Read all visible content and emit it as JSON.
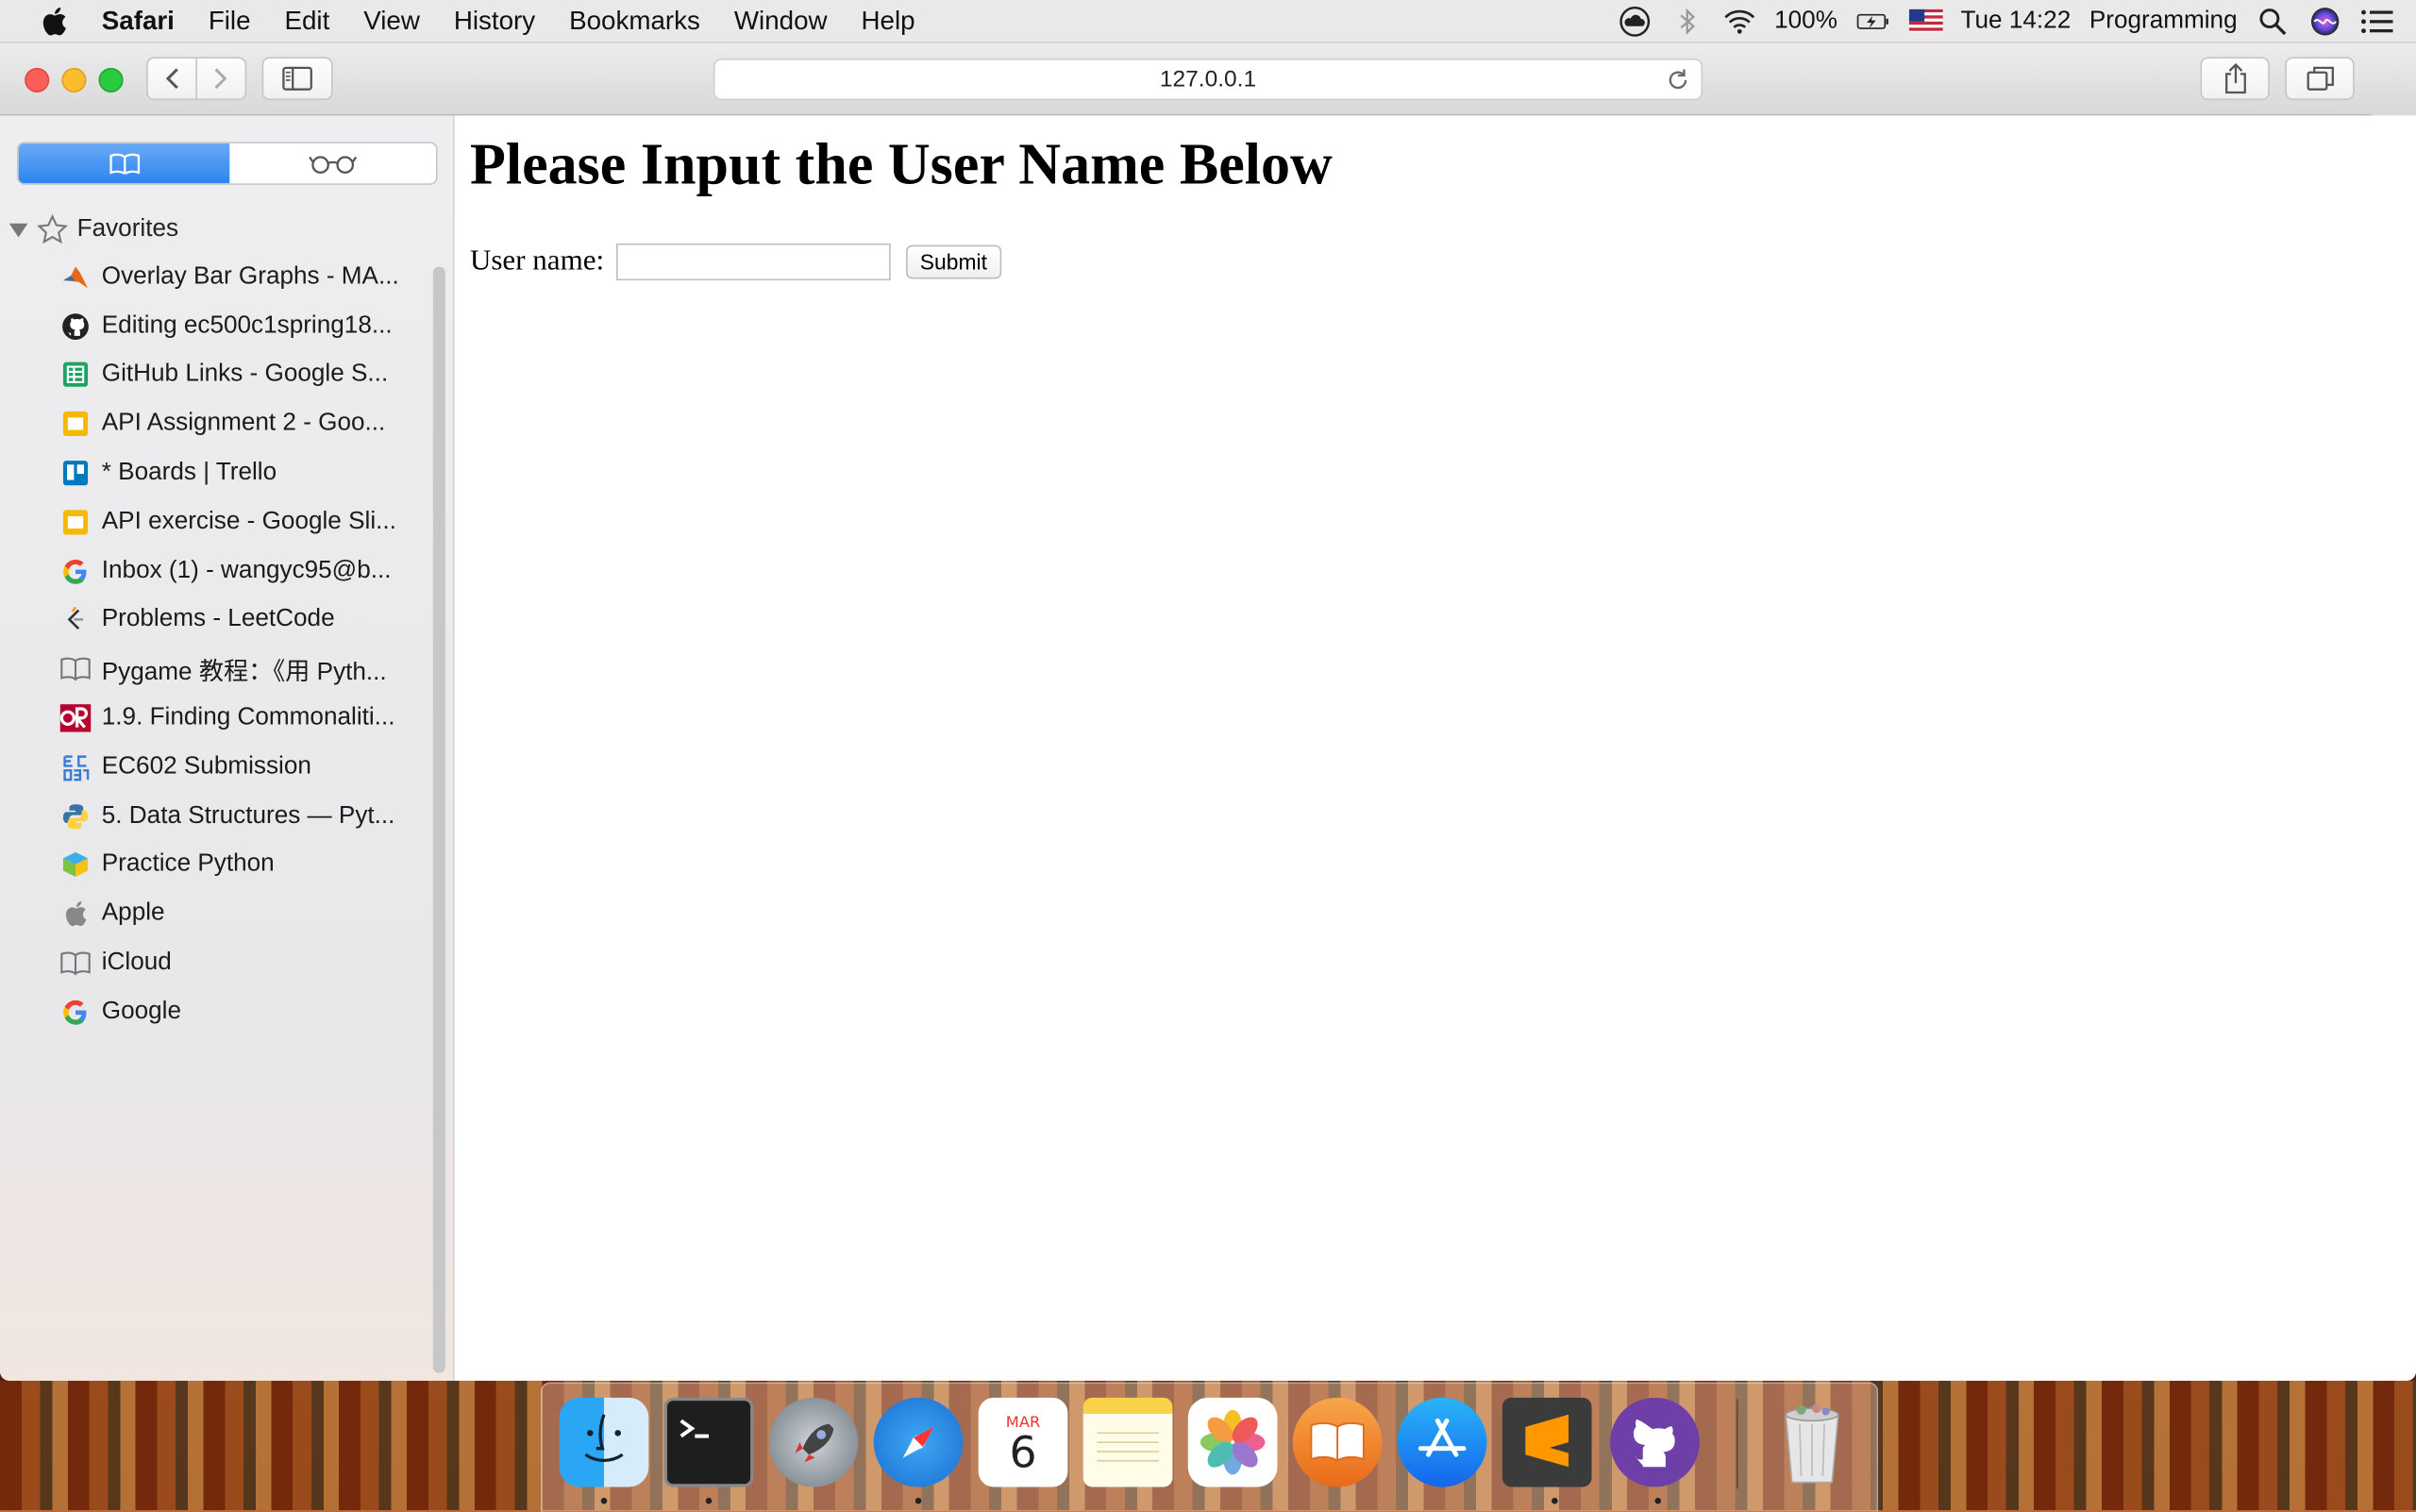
{
  "menubar": {
    "app": "Safari",
    "items": [
      "File",
      "Edit",
      "View",
      "History",
      "Bookmarks",
      "Window",
      "Help"
    ],
    "battery": "100%",
    "clock": "Tue 14:22",
    "user": "Programming"
  },
  "browser": {
    "url": "127.0.0.1"
  },
  "sidebar": {
    "section_title": "Favorites",
    "favorites": [
      {
        "label": "Overlay Bar Graphs - MA...",
        "icon": "matlab-icon"
      },
      {
        "label": "Editing ec500c1spring18...",
        "icon": "github-icon"
      },
      {
        "label": "GitHub Links - Google S...",
        "icon": "google-sheets-icon"
      },
      {
        "label": "API Assignment 2 - Goo...",
        "icon": "google-slides-icon"
      },
      {
        "label": "* Boards | Trello",
        "icon": "trello-icon"
      },
      {
        "label": "API exercise - Google Sli...",
        "icon": "google-slides-icon"
      },
      {
        "label": "Inbox (1) - wangyc95@b...",
        "icon": "google-icon"
      },
      {
        "label": "Problems - LeetCode",
        "icon": "leetcode-icon"
      },
      {
        "label": "Pygame 教程：《用 Pyth...",
        "icon": "book-icon"
      },
      {
        "label": "1.9. Finding Commonaliti...",
        "icon": "oreilly-icon"
      },
      {
        "label": "EC602 Submission",
        "icon": "ec602-icon"
      },
      {
        "label": "5. Data Structures — Pyt...",
        "icon": "python-icon"
      },
      {
        "label": "Practice Python",
        "icon": "practice-python-icon"
      },
      {
        "label": "Apple",
        "icon": "apple-icon"
      },
      {
        "label": "iCloud",
        "icon": "book-icon"
      },
      {
        "label": "Google",
        "icon": "google-icon"
      }
    ]
  },
  "page": {
    "title": "Please Input the User Name Below",
    "field_label": "User name:",
    "field_value": "",
    "submit_label": "Submit"
  },
  "dock": {
    "calendar_month": "MAR",
    "calendar_day": "6"
  }
}
